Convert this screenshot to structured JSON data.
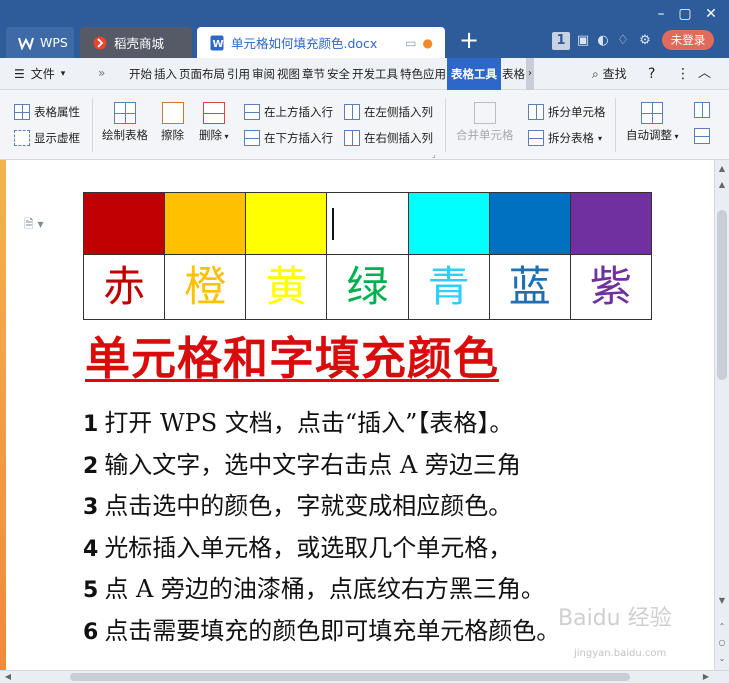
{
  "tabs": [
    {
      "label": "WPS",
      "icon": "wps-logo-icon"
    },
    {
      "label": "稻壳商城",
      "icon": "daoke-icon"
    },
    {
      "label": "单元格如何填充颜色.docx",
      "icon": "word-doc-icon",
      "active": true
    }
  ],
  "header": {
    "login_label": "未登录",
    "badge_count": "1"
  },
  "menu": {
    "file_label": "文件",
    "tabs": [
      "开始",
      "插入",
      "页面布局",
      "引用",
      "审阅",
      "视图",
      "章节",
      "安全",
      "开发工具",
      "特色应用",
      "表格工具",
      "表格"
    ],
    "active_tab": "表格工具",
    "search_label": "查找"
  },
  "ribbon": {
    "table_props": "表格属性",
    "show_gridlines": "显示虚框",
    "draw_table": "绘制表格",
    "erase": "擦除",
    "delete": "删除",
    "insert_above": "在上方插入行",
    "insert_below": "在下方插入行",
    "insert_left": "在左侧插入列",
    "insert_right": "在右侧插入列",
    "merge_cells": "合并单元格",
    "split_cells": "拆分单元格",
    "split_table": "拆分表格",
    "auto_fit": "自动调整"
  },
  "document": {
    "color_table": {
      "swatches": [
        "#c00000",
        "#ffc000",
        "#ffff00",
        "#ffffff",
        "#00ffff",
        "#0070c0",
        "#7030a0"
      ],
      "chars": [
        {
          "text": "赤",
          "color": "#c00000"
        },
        {
          "text": "橙",
          "color": "#ffc000"
        },
        {
          "text": "黄",
          "color": "#ffff00"
        },
        {
          "text": "绿",
          "color": "#00b050"
        },
        {
          "text": "青",
          "color": "#33ccff"
        },
        {
          "text": "蓝",
          "color": "#1f6fb5"
        },
        {
          "text": "紫",
          "color": "#7030a0"
        }
      ]
    },
    "title": "单元格和字填充颜色",
    "title_color": "#d90b0b",
    "steps": [
      {
        "num": "1",
        "text": "打开 WPS 文档，点击“插入”【表格】。"
      },
      {
        "num": "2",
        "text": "输入文字，选中文字右击点 A 旁边三角"
      },
      {
        "num": "3",
        "text": "点击选中的颜色，字就变成相应颜色。"
      },
      {
        "num": "4",
        "text": "光标插入单元格，或选取几个单元格，"
      },
      {
        "num": "5",
        "text": "点 A 旁边的油漆桶，点底纹右方黑三角。"
      },
      {
        "num": "6",
        "text": "点击需要填充的颜色即可填充单元格颜色。"
      }
    ]
  },
  "watermark": {
    "text": "Baidu 经验",
    "sub": "jingyan.baidu.com"
  }
}
